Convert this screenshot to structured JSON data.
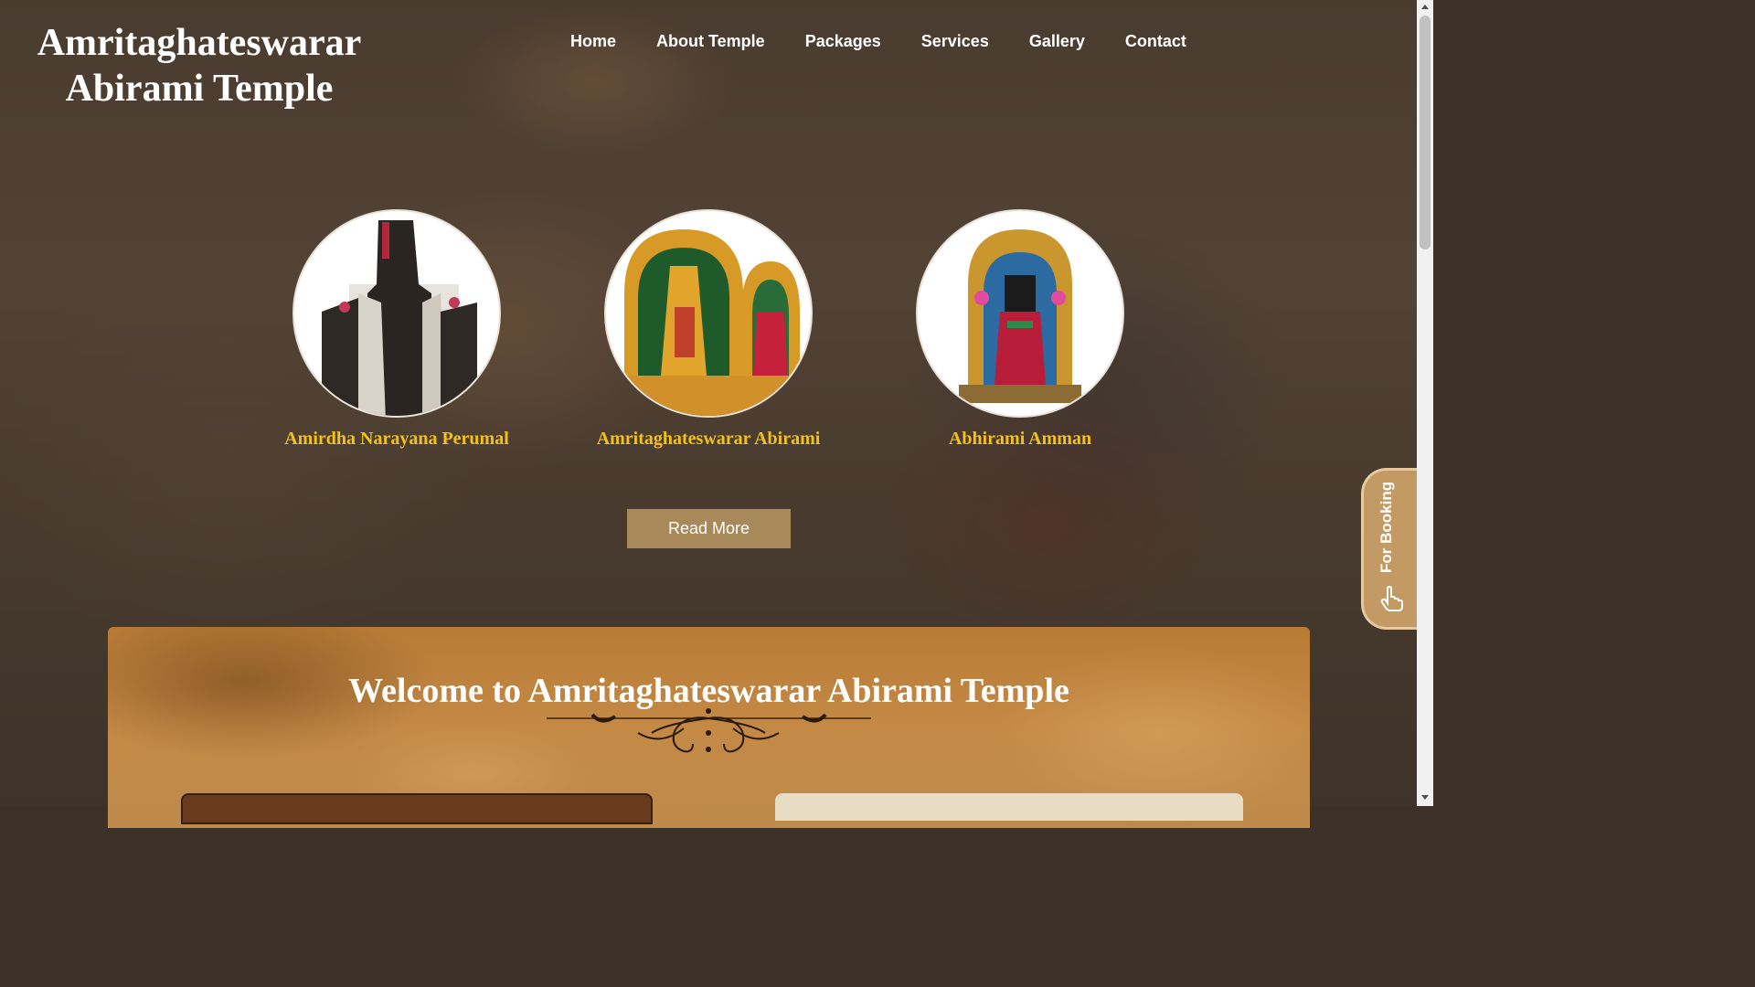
{
  "brand": {
    "line1": "Amritaghateswarar",
    "line2": "Abirami Temple"
  },
  "nav": [
    {
      "label": "Home"
    },
    {
      "label": "About Temple"
    },
    {
      "label": "Packages"
    },
    {
      "label": "Services"
    },
    {
      "label": "Gallery"
    },
    {
      "label": "Contact"
    }
  ],
  "deities": [
    {
      "name": "Amirdha Narayana Perumal",
      "image": "amirdha-narayana-perumal-idol"
    },
    {
      "name": "Amritaghateswarar Abirami",
      "image": "amritaghateswarar-abirami-idol"
    },
    {
      "name": "Abhirami Amman",
      "image": "abhirami-amman-idol"
    }
  ],
  "hero": {
    "read_more_label": "Read More"
  },
  "booking": {
    "label": "For Booking",
    "icon": "hand-pointer-icon"
  },
  "welcome": {
    "title": "Welcome to Amritaghateswarar Abirami Temple"
  },
  "colors": {
    "accent_gold": "#f2c21b",
    "button_bg": "#a8895a",
    "booking_bg": "#c39a63"
  }
}
